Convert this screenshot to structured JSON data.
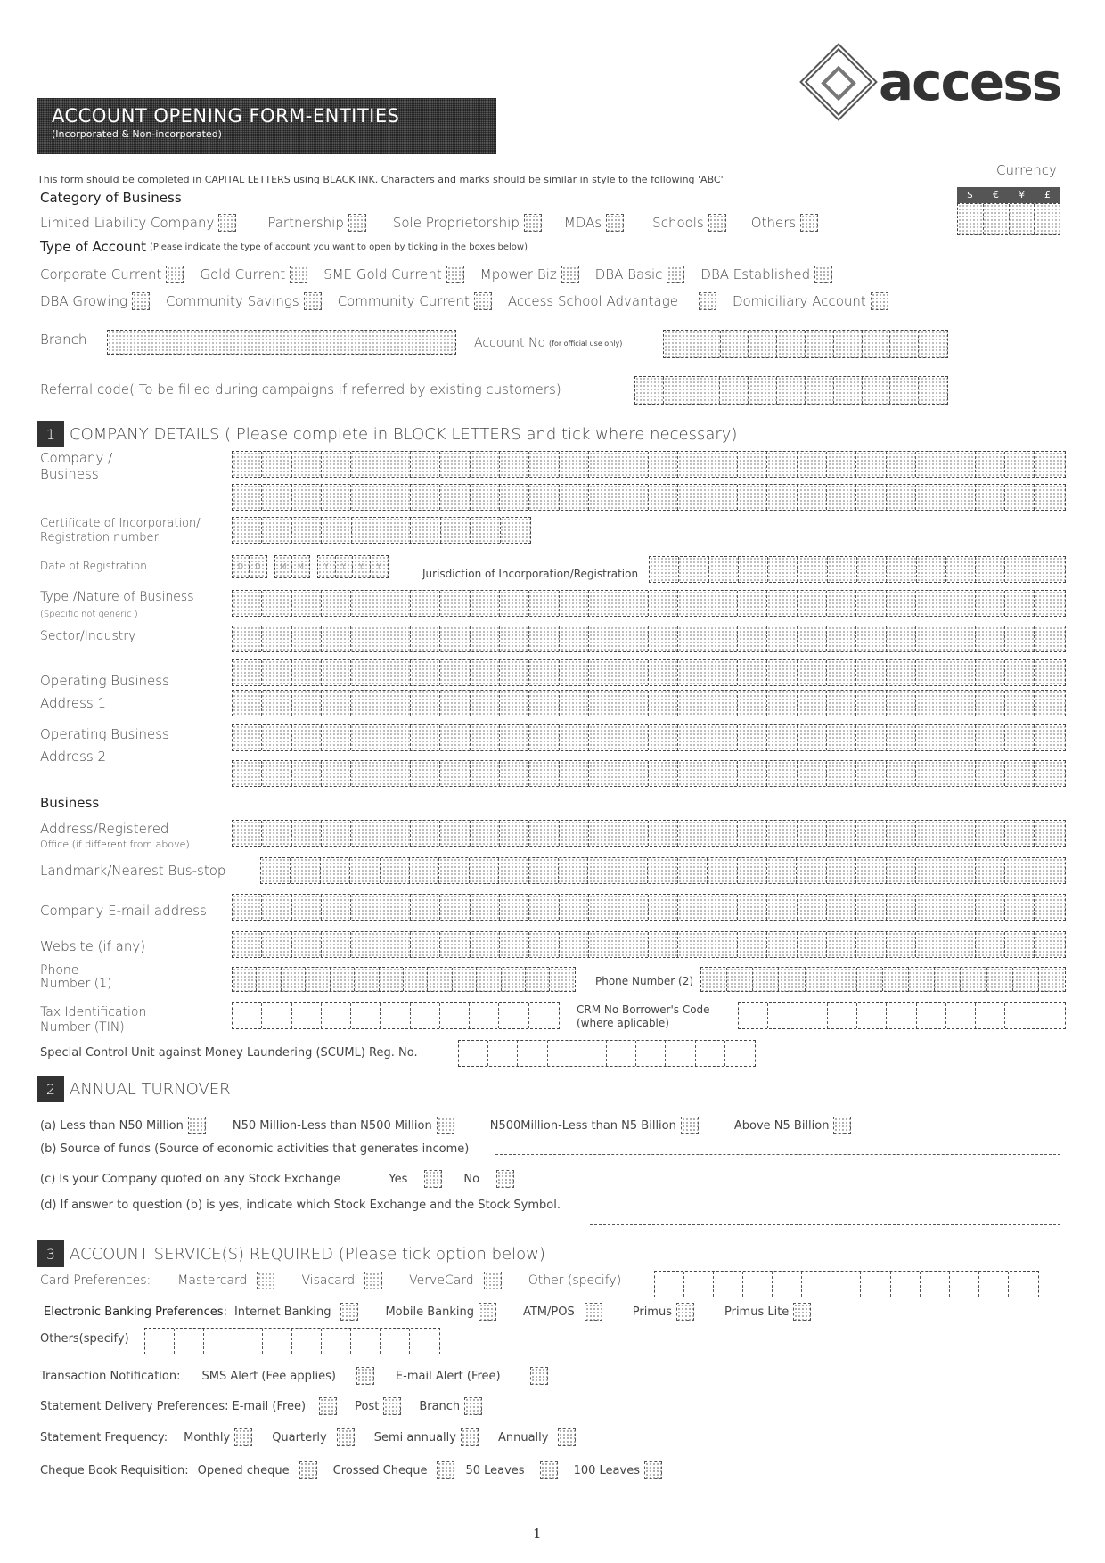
{
  "header": {
    "title": "ACCOUNT OPENING FORM-ENTITIES",
    "subtitle": "(Incorporated & Non-incorporated)",
    "logo_text": "access",
    "instruction": "This form should be completed in CAPITAL LETTERS using BLACK INK. Characters and marks should be similar in style to the following 'ABC'",
    "currency_label": "Currency",
    "currency_symbols": [
      "$",
      "€",
      "¥",
      "£"
    ]
  },
  "category": {
    "heading": "Category of Business",
    "options": [
      "Limited Liability Company",
      "Partnership",
      "Sole Proprietorship",
      "MDAs",
      "Schools",
      "Others"
    ]
  },
  "account_type": {
    "heading": "Type of Account",
    "note": "(Please indicate the type of account you want to open by ticking in the boxes below)",
    "row1": [
      "Corporate Current",
      "Gold Current",
      "SME Gold Current",
      "Mpower Biz",
      "DBA Basic",
      "DBA Established"
    ],
    "row2": [
      "DBA Growing",
      "Community Savings",
      "Community Current",
      "Access School Advantage",
      "Domiciliary Account"
    ]
  },
  "branch_label": "Branch",
  "account_no": {
    "label": "Account No",
    "note": "(for official use only)"
  },
  "referral_label": "Referral code( To be filled during campaigns if referred by existing customers)",
  "section1": {
    "num": "1",
    "title": "COMPANY DETAILS ( Please complete in BLOCK LETTERS and tick where necessary)",
    "company_label_1": "Company /",
    "company_label_2": "Business",
    "cert_label_1": "Certificate of Incorporation/",
    "cert_label_2": "Registration  number",
    "date_label": "Date of Registration",
    "date_placeholders": [
      "D",
      "D",
      "M",
      "M",
      "Y",
      "Y",
      "Y",
      "Y"
    ],
    "jurisdiction_label": "Jurisdiction of Incorporation/Registration",
    "nature_label": "Type /Nature of Business",
    "nature_note": "(Specific not generic )",
    "sector_label": "Sector/Industry",
    "op1_label_1": "Operating Business",
    "op1_label_2": "Address 1",
    "op2_label_1": "Operating Business",
    "op2_label_2": "Address 2",
    "business_heading": "Business",
    "reg_label_1": "Address/Registered",
    "reg_label_2": "Office (if different from above)",
    "landmark_label": "Landmark/Nearest Bus-stop",
    "email_label": "Company E-mail address",
    "website_label": "Website (if any)",
    "phone1_label_1": "Phone",
    "phone1_label_2": "Number (1)",
    "phone2_label": "Phone Number (2)",
    "tin_label_1": "Tax Identification",
    "tin_label_2": "Number (TIN)",
    "crm_label_1": "CRM No Borrower's Code",
    "crm_label_2": "(where aplicable)",
    "scuml_label": "Special Control Unit against Money Laundering (SCUML) Reg. No."
  },
  "section2": {
    "num": "2",
    "title": "ANNUAL TURNOVER",
    "turnover_options": [
      "(a) Less than N50 Million",
      "N50 Million-Less than N500 Million",
      "N500Million-Less than N5 Billion",
      "Above N5 Billion"
    ],
    "source_label": "(b) Source of funds (Source of economic activities that generates income)",
    "quoted_label": "(c) Is your Company quoted on any Stock Exchange",
    "yes_label": "Yes",
    "no_label": "No",
    "stock_label": "(d) If answer to question (b) is yes, indicate which Stock Exchange and the Stock Symbol."
  },
  "section3": {
    "num": "3",
    "title": "ACCOUNT SERVICE(S) REQUIRED (Please tick option below)",
    "card_label": "Card Preferences:",
    "card_options": [
      "Mastercard",
      "Visacard",
      "VerveCard"
    ],
    "card_other": "Other (specify)",
    "ebank_label": "Electronic Banking Preferences:",
    "ebank_options": [
      "Internet Banking",
      "Mobile Banking",
      "ATM/POS",
      "Primus",
      "Primus Lite"
    ],
    "others_label": "Others(specify)",
    "txn_label": "Transaction Notification:",
    "txn_options": [
      "SMS Alert (Fee applies)",
      "E-mail Alert (Free)"
    ],
    "stmt_delivery_label": "Statement Delivery Preferences:",
    "stmt_delivery_options": [
      "E-mail (Free)",
      "Post",
      "Branch"
    ],
    "stmt_freq_label": "Statement Frequency:",
    "stmt_freq_options": [
      "Monthly",
      "Quarterly",
      "Semi annually",
      "Annually"
    ],
    "cheque_label": "Cheque Book Requisition:",
    "cheque_options": [
      "Opened cheque",
      "Crossed Cheque",
      "50 Leaves",
      "100 Leaves"
    ]
  },
  "page_number": "1"
}
